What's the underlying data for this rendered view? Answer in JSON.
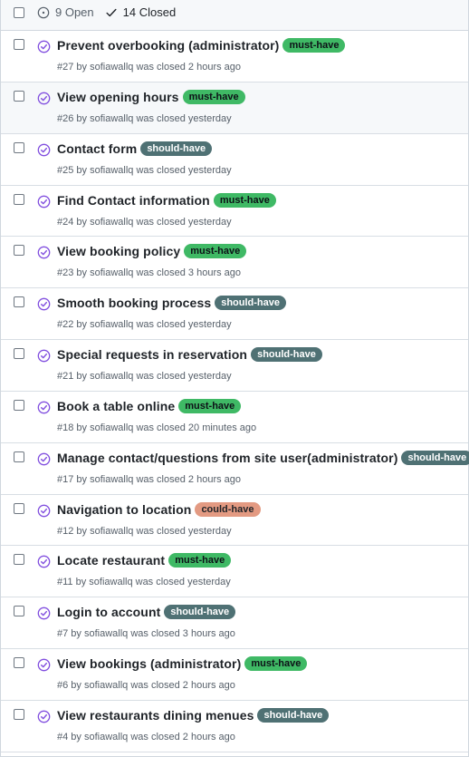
{
  "header": {
    "open_label": "9 Open",
    "closed_label": "14 Closed"
  },
  "label_colors": {
    "must-have": {
      "bg": "#3fb965",
      "fg": "#0d1117"
    },
    "should-have": {
      "bg": "#4f7174",
      "fg": "#ffffff"
    },
    "could-have": {
      "bg": "#e39a82",
      "fg": "#1f2328"
    }
  },
  "issues": [
    {
      "title": "Prevent overbooking (administrator)",
      "label": "must-have",
      "meta": "#27 by sofiawallq was closed 2 hours ago"
    },
    {
      "title": "View opening hours",
      "label": "must-have",
      "meta": "#26 by sofiawallq was closed yesterday"
    },
    {
      "title": "Contact form",
      "label": "should-have",
      "meta": "#25 by sofiawallq was closed yesterday"
    },
    {
      "title": "Find Contact information",
      "label": "must-have",
      "meta": "#24 by sofiawallq was closed yesterday"
    },
    {
      "title": "View booking policy",
      "label": "must-have",
      "meta": "#23 by sofiawallq was closed 3 hours ago"
    },
    {
      "title": "Smooth booking process",
      "label": "should-have",
      "meta": "#22 by sofiawallq was closed yesterday"
    },
    {
      "title": "Special requests in reservation",
      "label": "should-have",
      "meta": "#21 by sofiawallq was closed yesterday"
    },
    {
      "title": "Book a table online",
      "label": "must-have",
      "meta": "#18 by sofiawallq was closed 20 minutes ago"
    },
    {
      "title": "Manage contact/questions from site user(administrator)",
      "label": "should-have",
      "meta": "#17 by sofiawallq was closed 2 hours ago"
    },
    {
      "title": "Navigation to location",
      "label": "could-have",
      "meta": "#12 by sofiawallq was closed yesterday"
    },
    {
      "title": "Locate restaurant",
      "label": "must-have",
      "meta": "#11 by sofiawallq was closed yesterday"
    },
    {
      "title": "Login to account",
      "label": "should-have",
      "meta": "#7 by sofiawallq was closed 3 hours ago"
    },
    {
      "title": "View bookings (administrator)",
      "label": "must-have",
      "meta": "#6 by sofiawallq was closed 2 hours ago"
    },
    {
      "title": "View restaurants dining menues",
      "label": "should-have",
      "meta": "#4 by sofiawallq was closed 2 hours ago"
    }
  ]
}
